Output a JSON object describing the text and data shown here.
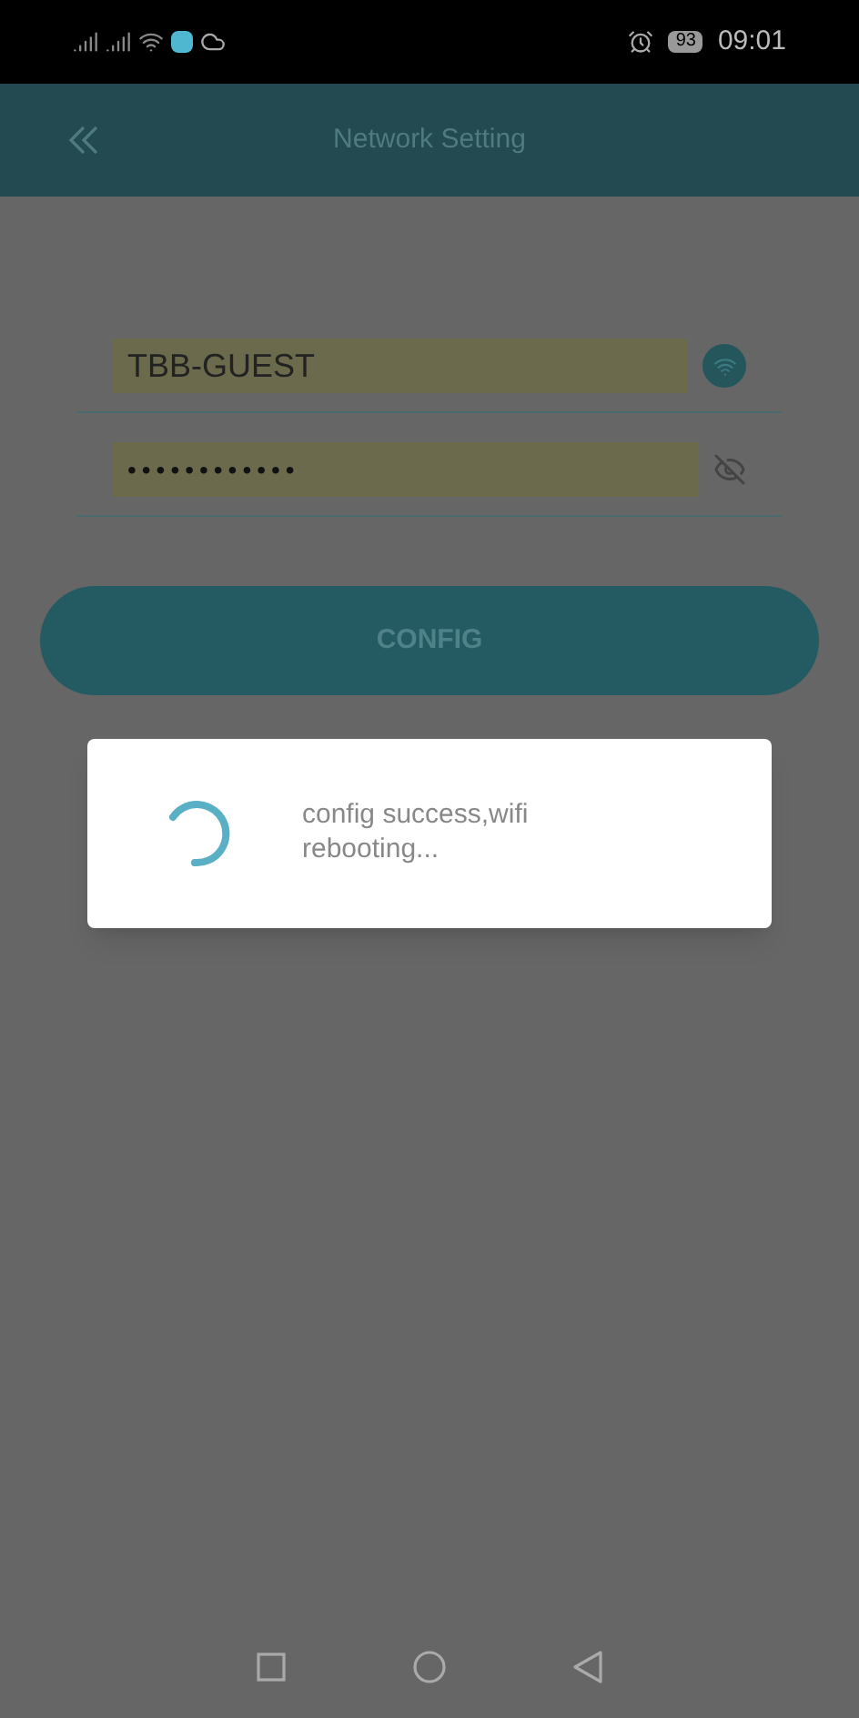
{
  "status_bar": {
    "battery": "93",
    "time": "09:01"
  },
  "header": {
    "title": "Network Setting"
  },
  "form": {
    "ssid": {
      "value": "TBB-GUEST"
    },
    "password": {
      "value": "••••••••••••",
      "visible": false
    },
    "config_button": "CONFIG"
  },
  "dialog": {
    "message": "config success,wifi rebooting..."
  }
}
